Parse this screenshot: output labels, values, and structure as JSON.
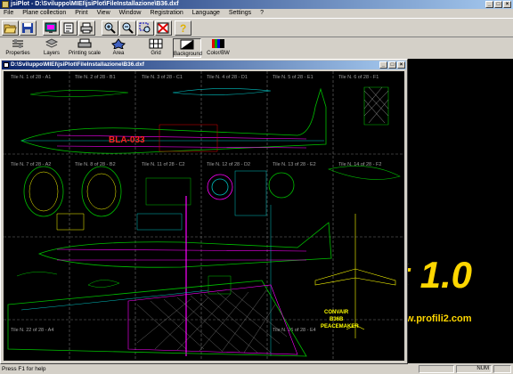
{
  "window": {
    "title": "jsiPlot - D:\\Sviluppo\\MIEI\\jsiPlot\\FileInstallazione\\B36.dxf"
  },
  "menu": [
    "File",
    "Plane collection",
    "Print",
    "View",
    "Window",
    "Registration",
    "Language",
    "Settings",
    "?"
  ],
  "toolbar_secondary": {
    "properties": "Properties",
    "layers": "Layers",
    "printing_scale": "Printing scale",
    "area": "Area",
    "grid": "Grid",
    "background": "Background",
    "color_bw": "Color/BW"
  },
  "document": {
    "title": "D:\\Sviluppo\\MIEI\\jsiPlot\\FileInstallazione\\B36.dxf"
  },
  "tiles": [
    "Tile N. 1 of 28 - A1",
    "Tile N. 2 of 28 - B1",
    "Tile N. 3 of 28 - C1",
    "Tile N. 4 of 28 - D1",
    "Tile N. 5 of 28 - E1",
    "Tile N. 6 of 28 - F1",
    "Tile N. 7 of 28 - A2",
    "Tile N. 8 of 28 - B2",
    "Tile N. 11 of 28 - C2",
    "Tile N. 12 of 28 - D2",
    "Tile N. 13 of 28 - E2",
    "Tile N. 14 of 28 - F2",
    "Tile N. 22 of 28 - A4",
    "Tile N. 26 of 28 - E4"
  ],
  "drawing_labels": {
    "registration": "BLA-033",
    "name1": "CONVAIR",
    "name2": "B36B",
    "name3": "PEACEMAKER"
  },
  "splash": {
    "logo": "t 1.0",
    "url": "w.profili2.com"
  },
  "status": {
    "message": "Press F1 for help",
    "indicator": "NUM"
  },
  "colors": {
    "titlebar": "#0a246a",
    "canvas": "#000000",
    "logo": "#ffd700",
    "drawing_green": "#00c000",
    "drawing_magenta": "#ff00ff"
  }
}
